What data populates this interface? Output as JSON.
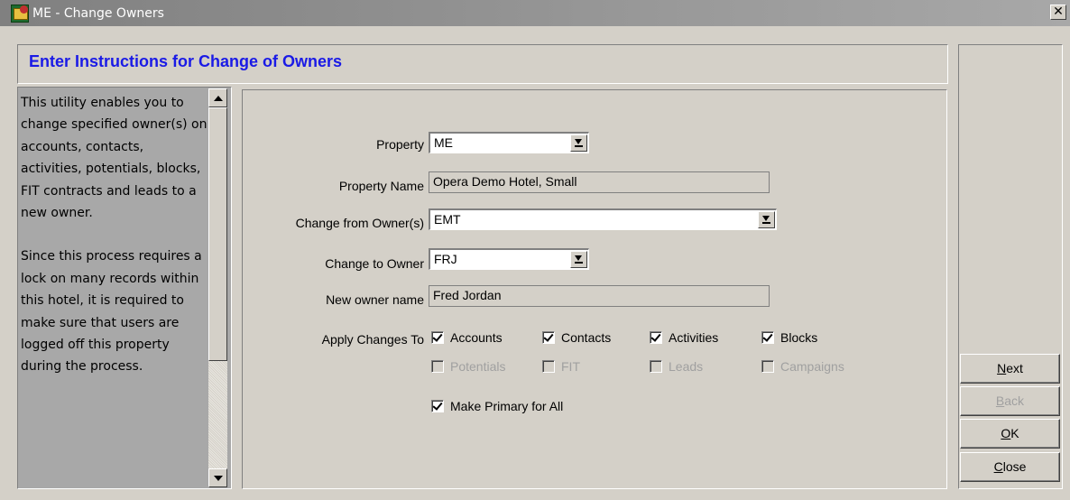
{
  "window": {
    "title": "ME - Change Owners",
    "close_glyph": "✕"
  },
  "heading": "Enter Instructions for Change of Owners",
  "info": {
    "paragraph1": "This utility enables you to change specified owner(s) on accounts, contacts, activities, potentials, blocks, FIT contracts and leads to a new owner.",
    "paragraph2": "Since this process requires a lock on many records within this hotel, it is required to make sure that users are logged off this property during the process."
  },
  "form": {
    "property_label": "Property",
    "property_value": "ME",
    "property_name_label": "Property Name",
    "property_name_value": "Opera Demo Hotel, Small",
    "change_from_label": "Change from Owner(s)",
    "change_from_value": "EMT",
    "change_to_label": "Change to Owner",
    "change_to_value": "FRJ",
    "new_owner_label": "New owner name",
    "new_owner_value": "Fred Jordan",
    "apply_label": "Apply Changes To"
  },
  "checkboxes": {
    "accounts": {
      "label": "Accounts",
      "checked": true,
      "enabled": true
    },
    "contacts": {
      "label": "Contacts",
      "checked": true,
      "enabled": true
    },
    "activities": {
      "label": "Activities",
      "checked": true,
      "enabled": true
    },
    "blocks": {
      "label": "Blocks",
      "checked": true,
      "enabled": true
    },
    "potentials": {
      "label": "Potentials",
      "checked": false,
      "enabled": false
    },
    "fit": {
      "label": "FIT",
      "checked": false,
      "enabled": false
    },
    "leads": {
      "label": "Leads",
      "checked": false,
      "enabled": false
    },
    "campaigns": {
      "label": "Campaigns",
      "checked": false,
      "enabled": false
    },
    "make_primary": {
      "label": "Make Primary for All",
      "checked": true,
      "enabled": true
    }
  },
  "buttons": {
    "next": {
      "mnemonic": "N",
      "rest": "ext",
      "enabled": true
    },
    "back": {
      "mnemonic": "B",
      "rest": "ack",
      "enabled": false
    },
    "ok": {
      "mnemonic": "O",
      "rest": "K",
      "enabled": true
    },
    "close": {
      "mnemonic": "C",
      "rest": "lose",
      "enabled": true
    }
  },
  "icons": [
    "app-icon",
    "dropdown-arrow-icon",
    "scroll-up-icon",
    "scroll-down-icon",
    "checkmark-icon"
  ]
}
